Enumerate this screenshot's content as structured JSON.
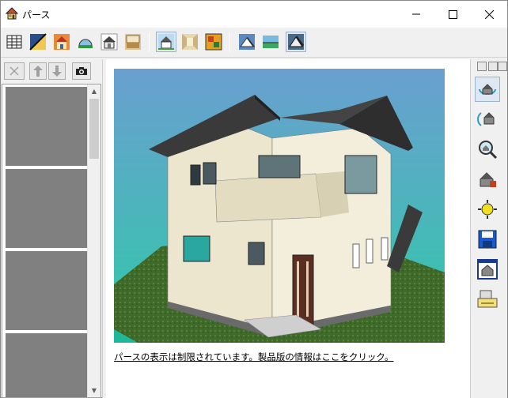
{
  "window": {
    "title": "パース",
    "controls": {
      "minimize": "minimize-icon",
      "maximize": "maximize-icon",
      "close": "close-icon"
    }
  },
  "toolbar": {
    "buttons": [
      {
        "name": "building-icon",
        "pressed": false
      },
      {
        "name": "diagonal-line-icon",
        "pressed": false
      },
      {
        "name": "house-sunset-icon",
        "pressed": false
      },
      {
        "name": "dome-icon",
        "pressed": false
      },
      {
        "name": "house-front-icon",
        "pressed": false
      },
      {
        "name": "house-interior-icon",
        "pressed": false
      },
      {
        "name": "house-exterior-icon",
        "pressed": true
      },
      {
        "name": "room-interior-icon",
        "pressed": false
      },
      {
        "name": "texture-icon",
        "pressed": false
      },
      {
        "name": "sky-roof-icon",
        "pressed": false
      },
      {
        "name": "horizon-icon",
        "pressed": false
      },
      {
        "name": "roof-outline-icon",
        "pressed": true
      }
    ]
  },
  "left_pane": {
    "tools": [
      "delete-icon",
      "move-up-icon",
      "move-down-icon",
      "camera-icon"
    ],
    "thumbnails_count": 4
  },
  "main": {
    "notice": "パースの表示は制限されています。製品版の情報はここをクリック。"
  },
  "right_bar": {
    "buttons": [
      {
        "name": "orbit-icon",
        "pressed": true
      },
      {
        "name": "rotate-icon",
        "pressed": false
      },
      {
        "name": "zoom-icon",
        "pressed": false
      },
      {
        "name": "walk-icon",
        "pressed": false
      },
      {
        "name": "sun-settings-icon",
        "pressed": false
      },
      {
        "name": "save-icon",
        "pressed": false
      },
      {
        "name": "window-view-icon",
        "pressed": false
      },
      {
        "name": "print-icon",
        "pressed": false
      }
    ]
  },
  "colors": {
    "sky_top": "#6a9fd0",
    "sky_bottom": "#2fc9a8",
    "grass": "#3f6a2a",
    "wall": "#ece6cf",
    "roof": "#3a3a3a",
    "thumb": "#808080"
  }
}
